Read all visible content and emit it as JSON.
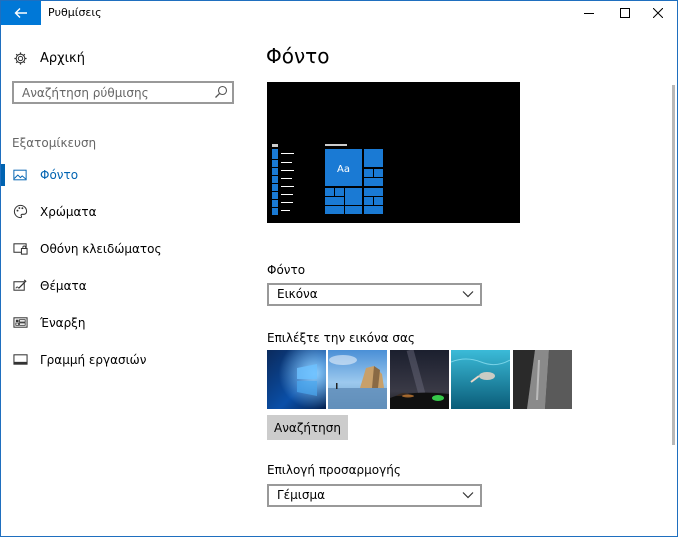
{
  "titlebar": {
    "title": "Ρυθμίσεις"
  },
  "sidebar": {
    "home_label": "Αρχική",
    "search_placeholder": "Αναζήτηση ρύθμισης",
    "section_label": "Εξατομίκευση",
    "items": [
      {
        "label": "Φόντο",
        "icon": "picture-icon",
        "active": true
      },
      {
        "label": "Χρώματα",
        "icon": "palette-icon",
        "active": false
      },
      {
        "label": "Οθόνη κλειδώματος",
        "icon": "lock-screen-icon",
        "active": false
      },
      {
        "label": "Θέματα",
        "icon": "themes-icon",
        "active": false
      },
      {
        "label": "Έναρξη",
        "icon": "start-icon",
        "active": false
      },
      {
        "label": "Γραμμή εργασιών",
        "icon": "taskbar-icon",
        "active": false
      }
    ]
  },
  "main": {
    "page_title": "Φόντο",
    "preview": {
      "tile_label": "Aa"
    },
    "background_label": "Φόντο",
    "background_value": "Εικόνα",
    "choose_picture_label": "Επιλέξτε την εικόνα σας",
    "pictures": [
      {
        "name": "windows-hero"
      },
      {
        "name": "beach-rocks"
      },
      {
        "name": "night-sky-tent"
      },
      {
        "name": "underwater-swimmer"
      },
      {
        "name": "rock-cliff"
      }
    ],
    "browse_label": "Αναζήτηση",
    "fit_label": "Επιλογή προσαρμογής",
    "fit_value": "Γέμισμα"
  },
  "colors": {
    "accent": "#0078d7",
    "accent_text": "#0063b1",
    "preview_bg": "#000000"
  }
}
